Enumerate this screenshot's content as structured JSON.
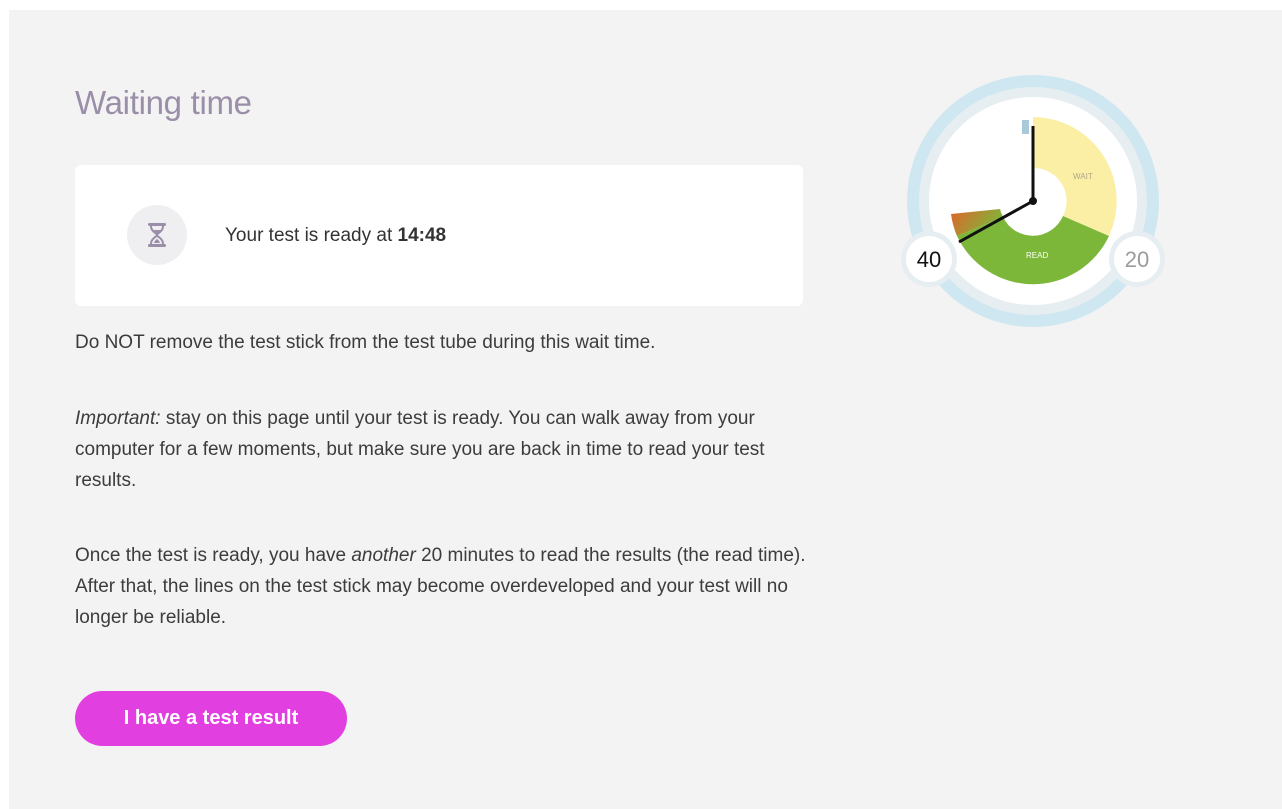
{
  "page": {
    "title": "Waiting time"
  },
  "ready_card": {
    "icon": "hourglass-icon",
    "text_prefix": "Your test is ready at ",
    "time": "14:48"
  },
  "instructions": {
    "p1": "Do NOT remove the test stick from the test tube during this wait time.",
    "p2_em": "Important:",
    "p2_rest": " stay on this page until your test is ready. You can walk away from your computer for a few moments, but make sure you are back in time to read your test results.",
    "p3_a": "Once the test is ready, you have ",
    "p3_em": "another",
    "p3_b": " 20 minutes to read the results (the read time). After that, the lines on the test stick may become overdeveloped and your test will no longer be reliable."
  },
  "actions": {
    "result_button": "I have a test result"
  },
  "timer": {
    "label_left": "40",
    "label_right": "20",
    "wait_label": "WAIT",
    "read_label": "READ",
    "colors": {
      "outer_ring": "#cfe7f0",
      "wait": "#fbefa6",
      "read": "#7db73a",
      "overtime": "#e0642a",
      "hands": "#111111"
    }
  }
}
